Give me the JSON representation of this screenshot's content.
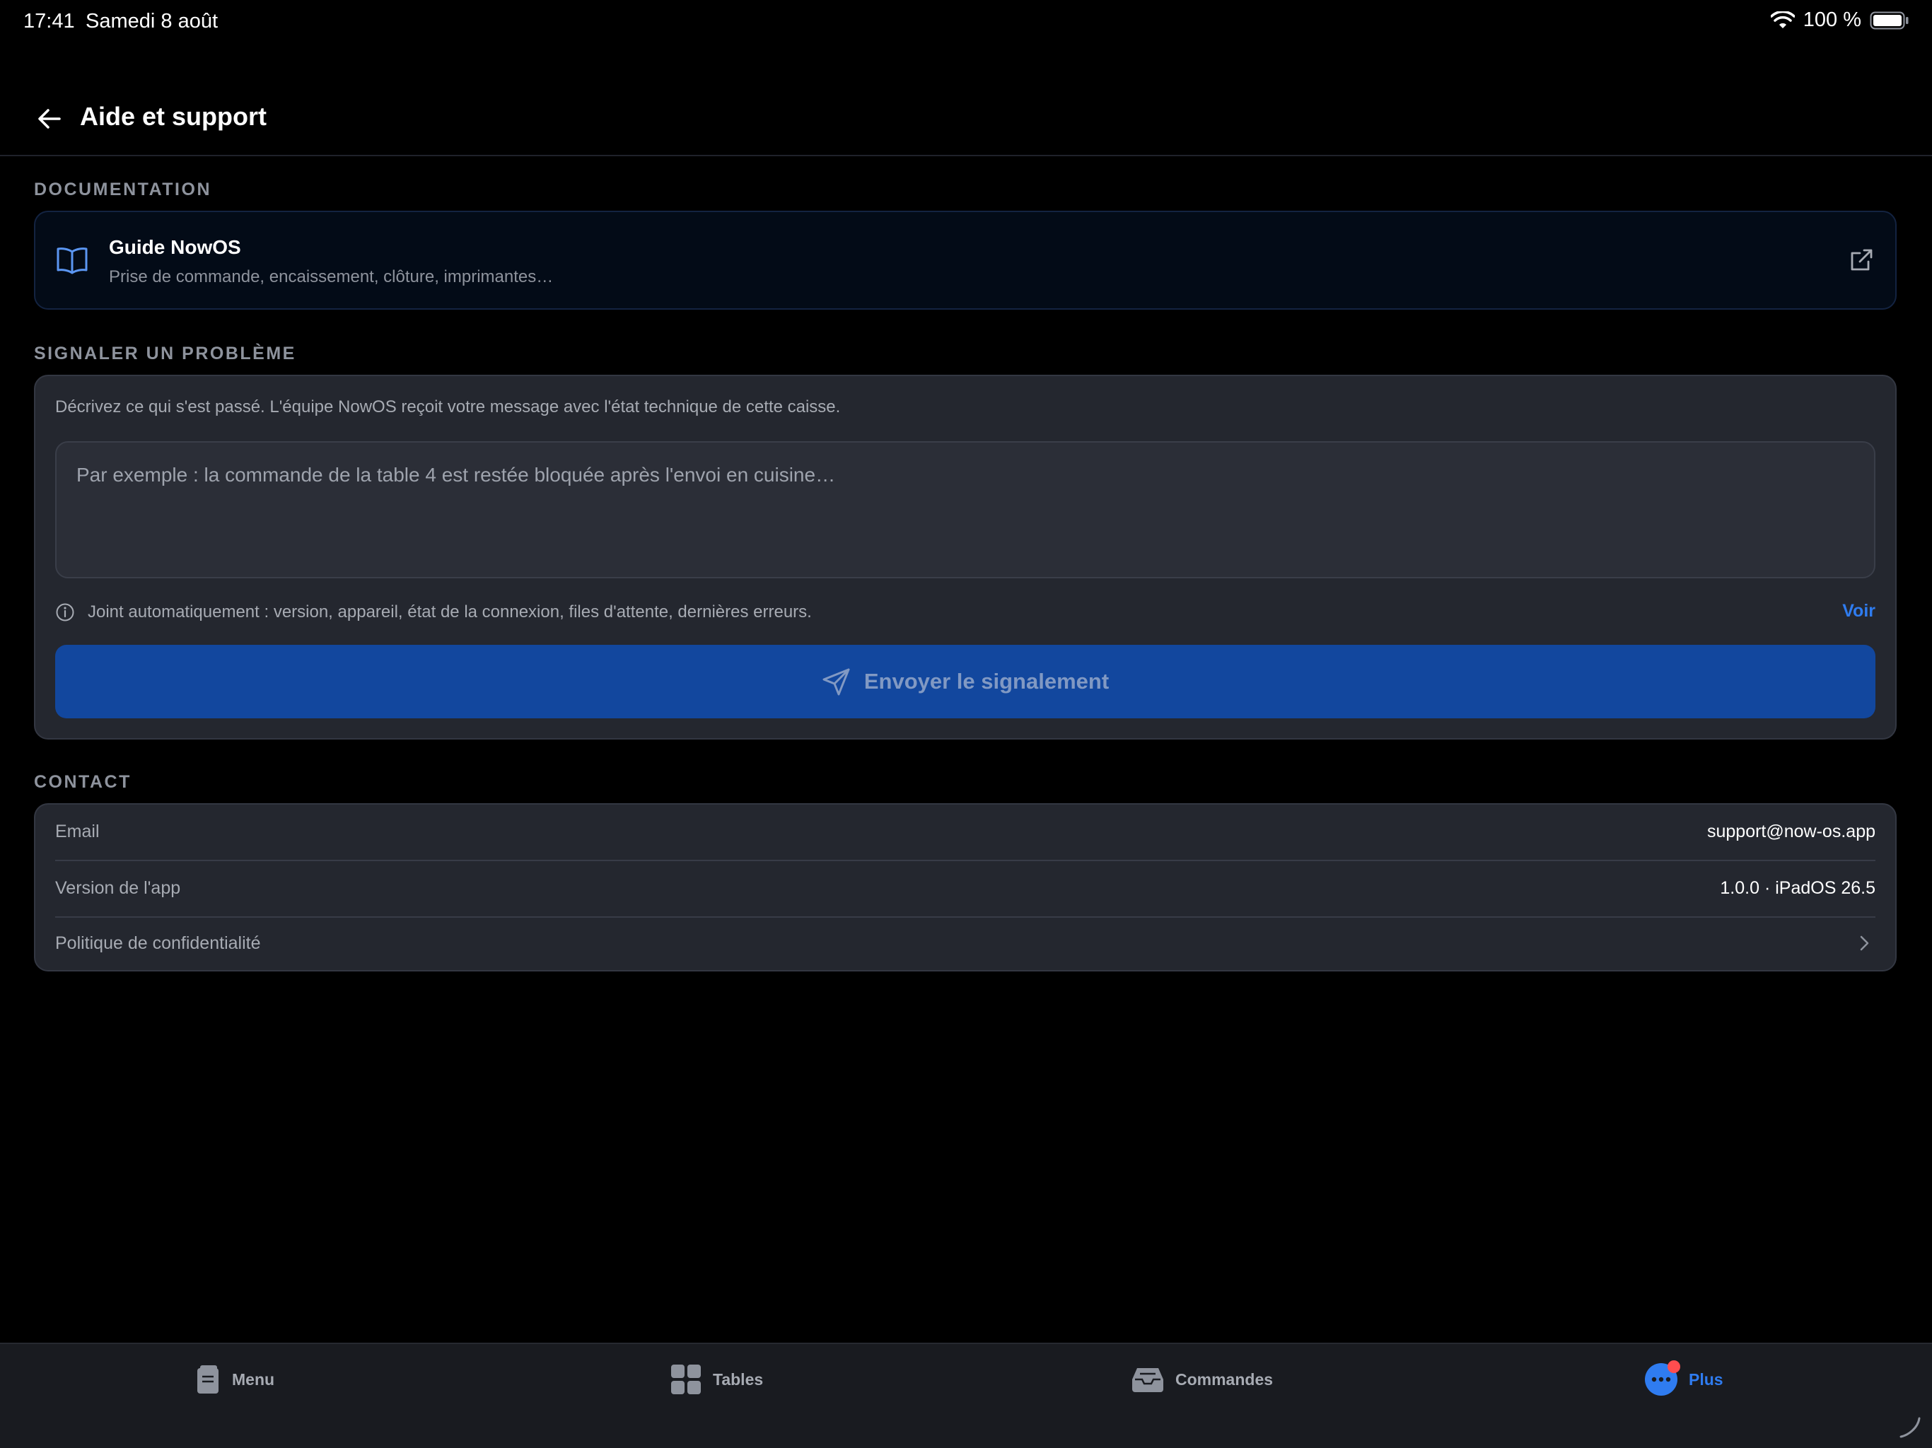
{
  "status_bar": {
    "time": "17:41",
    "date": "Samedi 8 août",
    "battery": "100 %"
  },
  "header": {
    "title": "Aide et support"
  },
  "documentation": {
    "section_label": "DOCUMENTATION",
    "guide_title": "Guide NowOS",
    "guide_subtitle": "Prise de commande, encaissement, clôture, imprimantes…"
  },
  "report": {
    "section_label": "SIGNALER UN PROBLÈME",
    "description": "Décrivez ce qui s'est passé. L'équipe NowOS reçoit votre message avec l'état technique de cette caisse.",
    "placeholder": "Par exemple : la commande de la table 4 est restée bloquée après l'envoi en cuisine…",
    "info_text": "Joint automatiquement : version, appareil, état de la connexion, files d'attente, dernières erreurs.",
    "view_link": "Voir",
    "send_label": "Envoyer le signalement"
  },
  "contact": {
    "section_label": "CONTACT",
    "rows": [
      {
        "label": "Email",
        "value": "support@now-os.app"
      },
      {
        "label": "Version de l'app",
        "value": "1.0.0 · iPadOS 26.5"
      },
      {
        "label": "Politique de confidentialité",
        "value": ""
      }
    ]
  },
  "tabbar": {
    "tabs": [
      {
        "label": "Menu",
        "icon": "menu-book-icon"
      },
      {
        "label": "Tables",
        "icon": "grid-icon"
      },
      {
        "label": "Commandes",
        "icon": "tray-icon"
      },
      {
        "label": "Plus",
        "icon": "more-dots-icon",
        "active": true
      }
    ]
  },
  "colors": {
    "accent": "#2f7cf0",
    "send_button": "#12479e",
    "card_bg": "#24272f",
    "badge": "#ff4d4f"
  }
}
